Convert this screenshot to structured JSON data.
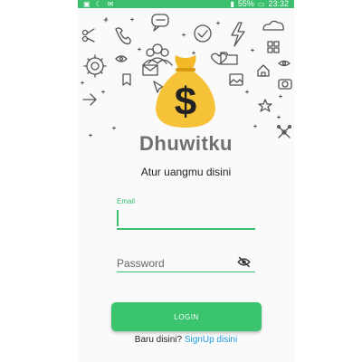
{
  "statusbar": {
    "battery": "55%",
    "time": "23:32"
  },
  "app": {
    "title": "Dhuwitku",
    "subtitle": "Atur uangmu disini"
  },
  "form": {
    "email_label": "Email",
    "email_value": "",
    "password_placeholder": "Password"
  },
  "login": {
    "label": "LOGIN"
  },
  "signup": {
    "prompt": "Baru disini?",
    "link": "SignUp disini"
  },
  "colors": {
    "accent": "#3bbf6d",
    "link": "#1e9ee0",
    "bag": "#f6c237"
  }
}
